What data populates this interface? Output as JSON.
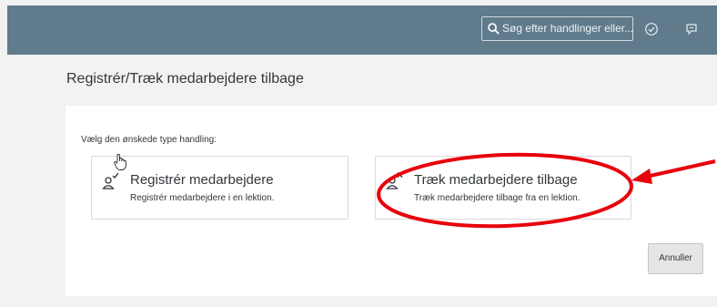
{
  "header": {
    "search_placeholder": "Søg efter handlinger eller...",
    "icons": [
      "search-icon",
      "check-circle-icon",
      "chat-bubble-icon"
    ],
    "background_color": "#5f7b8c"
  },
  "page": {
    "title": "Registrér/Træk medarbejdere tilbage"
  },
  "dialog": {
    "prompt": "Vælg den ønskede type handling:",
    "cards": [
      {
        "title": "Registrér medarbejdere",
        "subtitle": "Registrér medarbejdere i en lektion.",
        "icon": "person-check-icon"
      },
      {
        "title": "Træk medarbejdere tilbage",
        "subtitle": "Træk medarbejdere tilbage fra en lektion.",
        "icon": "person-x-icon"
      }
    ],
    "cancel_label": "Annuller"
  },
  "annotation": {
    "color": "#e8000b",
    "shapes": [
      "ellipse-highlight",
      "arrow"
    ]
  }
}
